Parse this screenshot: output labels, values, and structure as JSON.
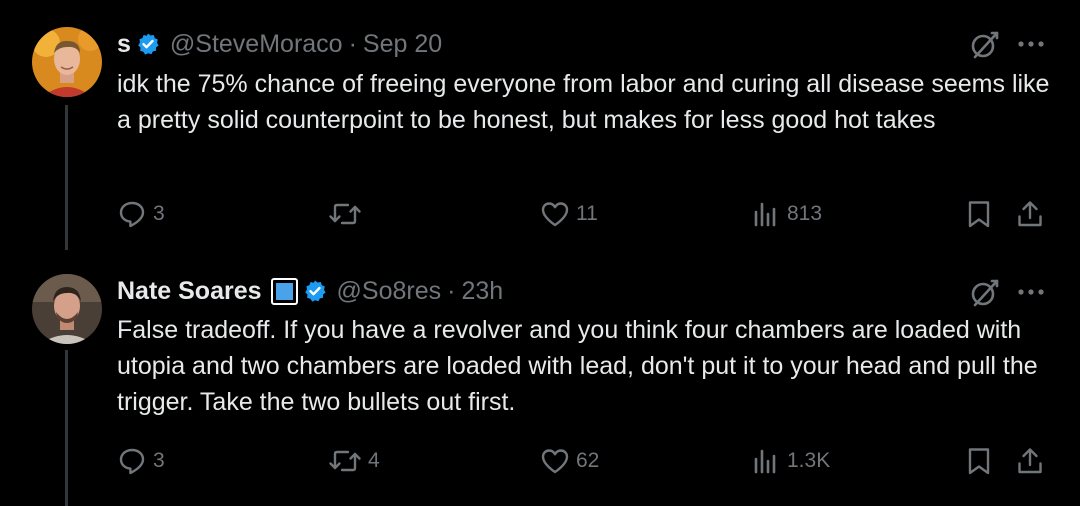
{
  "tweets": [
    {
      "name": "s",
      "handle": "@SteveMoraco",
      "separator": "·",
      "time": "Sep 20",
      "text": "idk the 75% chance of freeing everyone from labor and curing all disease seems like a pretty solid counterpoint to be honest, but makes for less good hot takes",
      "stats": {
        "replies": "3",
        "retweets": "",
        "likes": "11",
        "views": "813"
      }
    },
    {
      "name": "Nate Soares",
      "handle": "@So8res",
      "separator": "·",
      "time": "23h",
      "text": "False tradeoff. If you have a revolver and you think four chambers are loaded with utopia and two chambers are loaded with lead, don't put it to your head and pull the trigger. Take the two bullets out first.",
      "stats": {
        "replies": "3",
        "retweets": "4",
        "likes": "62",
        "views": "1.3K"
      }
    }
  ],
  "icons": {
    "reply": "reply-icon",
    "retweet": "retweet-icon",
    "like": "heart-icon",
    "views": "views-icon",
    "bookmark": "bookmark-icon",
    "share": "share-icon",
    "grok": "grok-icon",
    "more": "more-icon",
    "verified": "verified-badge-icon",
    "affiliate": "affiliate-badge-icon"
  },
  "colors": {
    "background": "#000000",
    "text": "#e7e9ea",
    "muted": "#71767b",
    "verified": "#1d9bf0",
    "thread_line": "#333639"
  }
}
